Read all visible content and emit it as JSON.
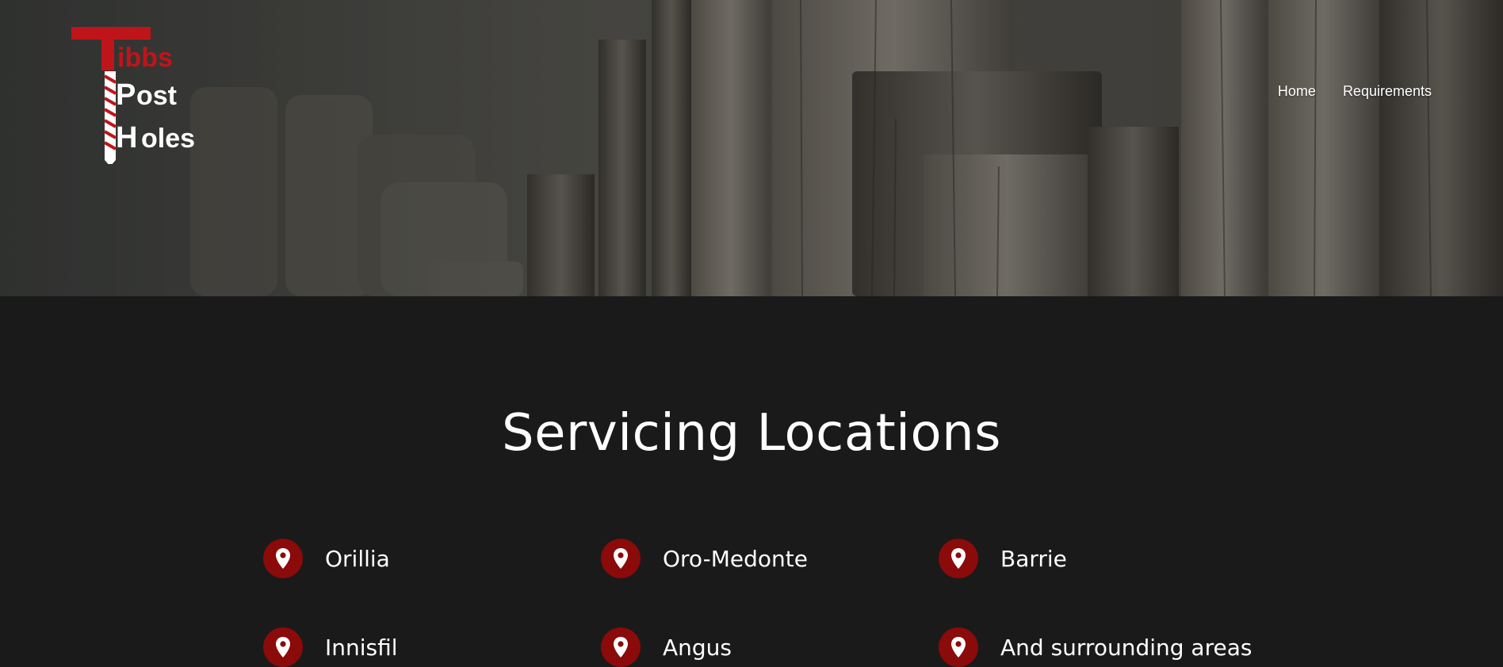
{
  "brand": {
    "logo_lines": [
      "Tibbs",
      "Post",
      "Holes"
    ],
    "logo_color": "#c0141b"
  },
  "nav": {
    "items": [
      {
        "label": "Home"
      },
      {
        "label": "Requirements"
      }
    ]
  },
  "hero": {
    "image_subject": "wooden-fence-posts-photo"
  },
  "locations_section": {
    "title": "Servicing Locations",
    "icon": "map-pin-icon",
    "badge_color": "#8b0a0a",
    "items": [
      {
        "label": "Orillia"
      },
      {
        "label": "Oro-Medonte"
      },
      {
        "label": "Barrie"
      },
      {
        "label": "Innisfil"
      },
      {
        "label": "Angus"
      },
      {
        "label": "And surrounding areas"
      }
    ]
  }
}
